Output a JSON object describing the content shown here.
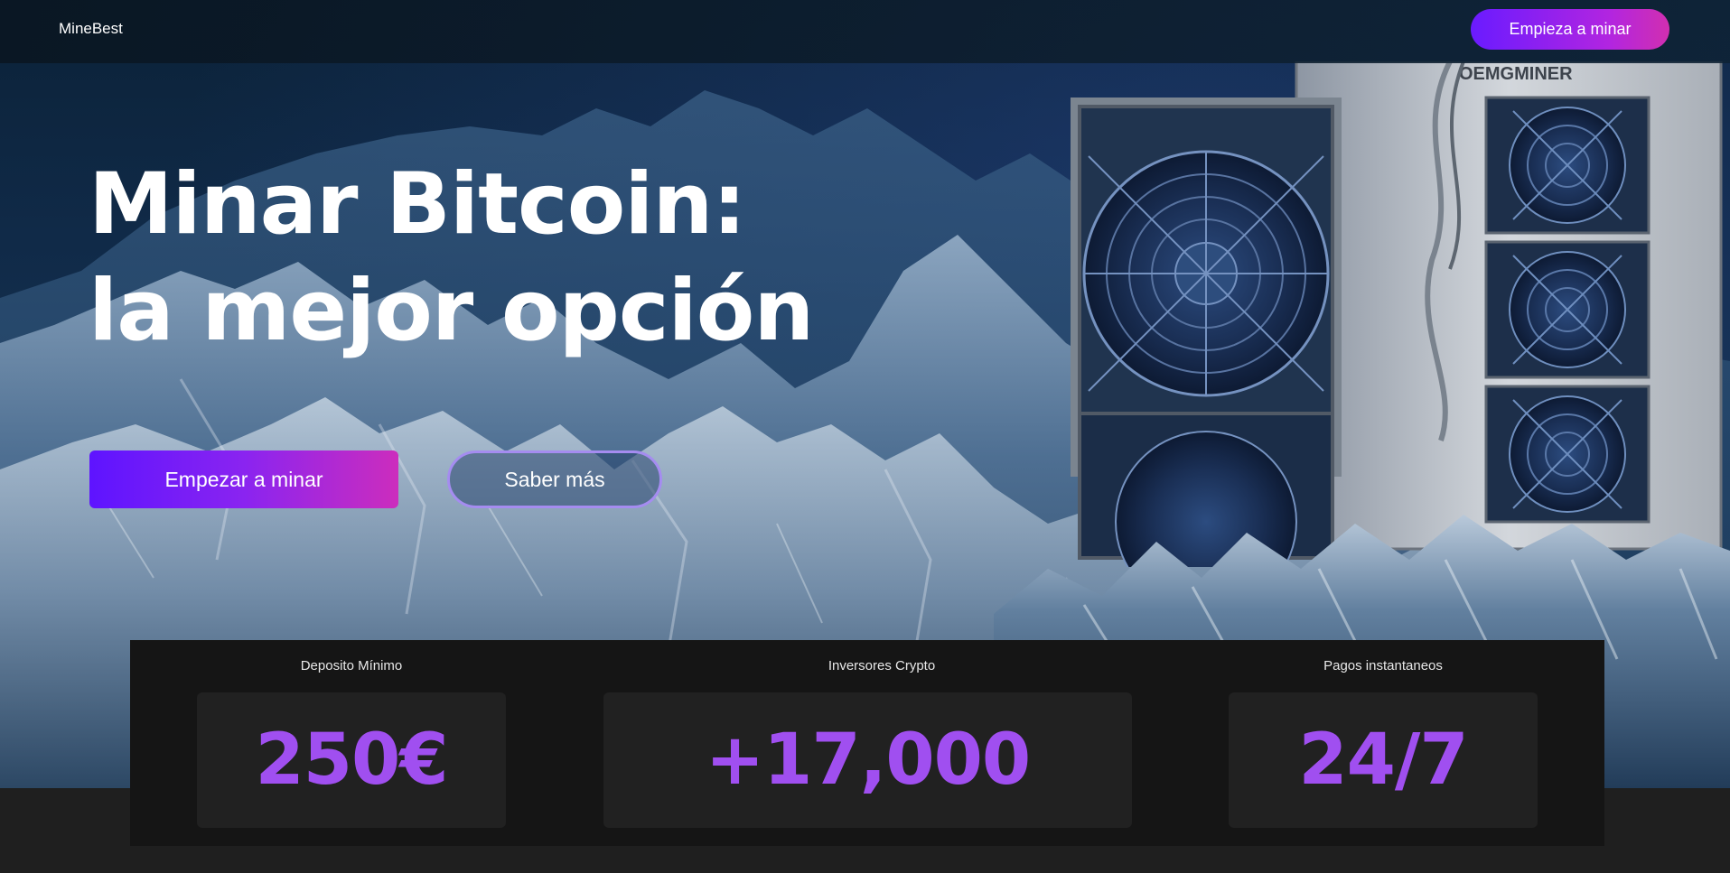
{
  "nav": {
    "brand": "MineBest",
    "cta_label": "Empieza a minar"
  },
  "hero": {
    "title_line1": "Minar Bitcoin:",
    "title_line2": "la mejor opción",
    "primary_button": "Empezar a minar",
    "secondary_button": "Saber más"
  },
  "miner_brand": "OEMGMINER",
  "stats": [
    {
      "label": "Deposito Mínimo",
      "value": "250€"
    },
    {
      "label": "Inversores Crypto",
      "value": "+17,000"
    },
    {
      "label": "Pagos instantaneos",
      "value": "24/7"
    }
  ],
  "colors": {
    "accent_purple": "#a04ff0",
    "gradient_start": "#6a1bff",
    "gradient_end": "#d12fb0",
    "panel_bg": "#151515",
    "card_bg": "#212121"
  }
}
